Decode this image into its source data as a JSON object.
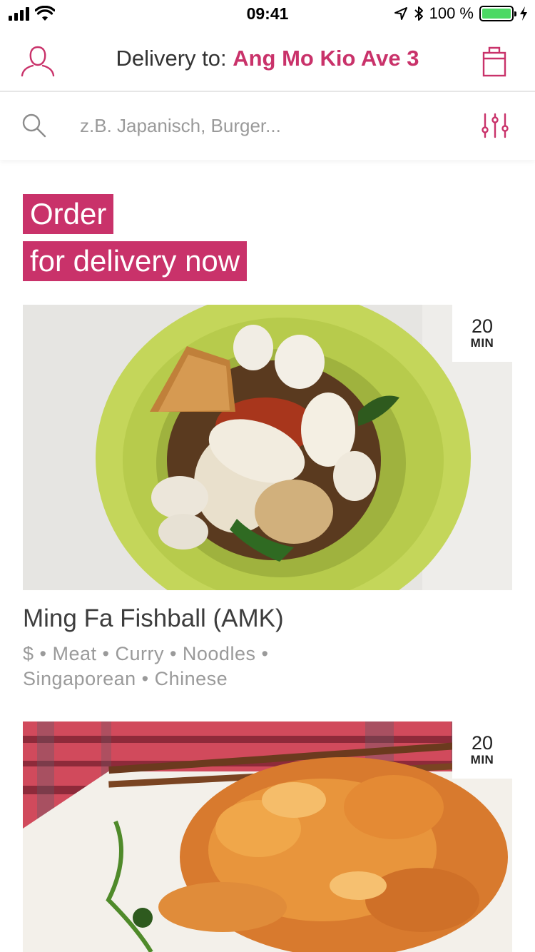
{
  "status_bar": {
    "time": "09:41",
    "battery_text": "100 %"
  },
  "header": {
    "delivery_label": "Delivery to:",
    "delivery_address": "Ang Mo Kio Ave 3"
  },
  "search": {
    "placeholder": "z.B. Japanisch, Burger..."
  },
  "hero": {
    "line1": "Order",
    "line2": "for delivery now"
  },
  "restaurants": [
    {
      "name": "Ming Fa Fishball (AMK)",
      "tags_line1": "$  •  Meat  •  Curry  •  Noodles  •",
      "tags_line2": "Singaporean  •  Chinese",
      "eta_value": "20",
      "eta_unit": "MIN"
    },
    {
      "name": "",
      "eta_value": "20",
      "eta_unit": "MIN"
    }
  ],
  "colors": {
    "accent": "#c9326a",
    "battery": "#4cd964"
  }
}
